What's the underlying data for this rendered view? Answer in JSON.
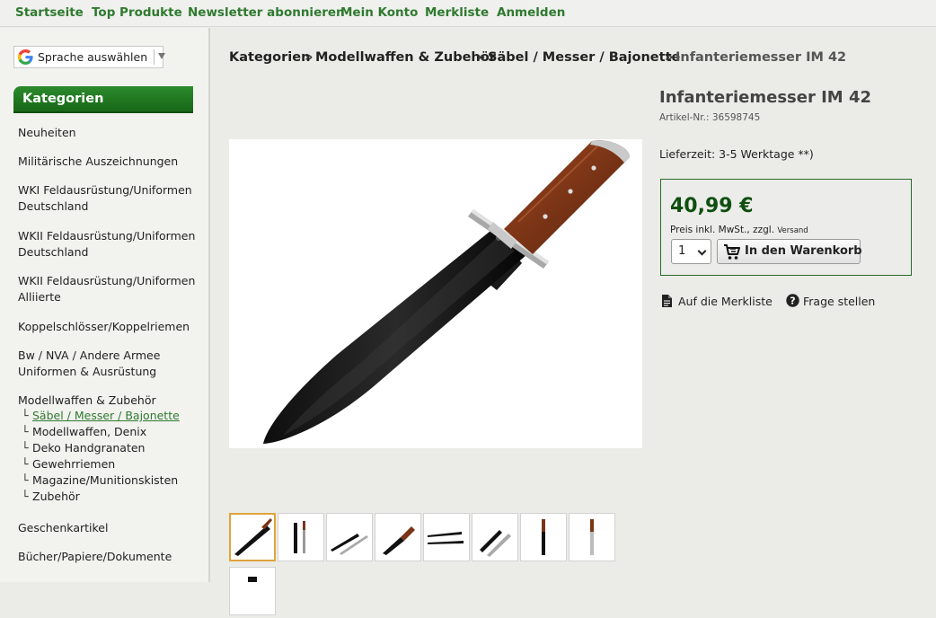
{
  "topnav": {
    "items": [
      "Startseite",
      "Top Produkte",
      "Newsletter abonnieren",
      "Mein Konto",
      "Merkliste",
      "Anmelden"
    ]
  },
  "language": {
    "label": "Sprache auswählen"
  },
  "sidebar": {
    "heading": "Kategorien",
    "items": [
      "Neuheiten",
      "Militärische Auszeichnungen",
      "WKI Feldausrüstung/Uniformen Deutschland",
      "WKII Feldausrüstung/Uniformen Deutschland",
      "WKII Feldausrüstung/Uniformen Alliierte",
      "Koppelschlösser/Koppelriemen",
      "Bw / NVA / Andere Armee Uniformen & Ausrüstung",
      "Modellwaffen & Zubehör",
      "Geschenkartikel",
      "Bücher/Papiere/Dokumente"
    ],
    "subitems": [
      "Säbel / Messer / Bajonette",
      "Modellwaffen, Denix",
      "Deko Handgranaten",
      "Gewehrriemen",
      "Magazine/Munitionskisten",
      "Zubehör"
    ]
  },
  "breadcrumb": {
    "items": [
      "Kategorien",
      "Modellwaffen & Zubehör",
      "Säbel / Messer / Bajonette",
      "Infanteriemesser IM 42"
    ],
    "separator": "»"
  },
  "product": {
    "title": "Infanteriemesser IM 42",
    "article_no": "Artikel-Nr.: 36598745",
    "delivery": "Lieferzeit: 3-5 Werktage **)",
    "price": "40,99 €",
    "vat_note": "Preis inkl. MwSt., zzgl.",
    "shipping_link": "Versand",
    "quantity": "1",
    "cart_button": "In den Warenkorb",
    "wishlist_link": "Auf die Merkliste",
    "question_link": "Frage stellen"
  },
  "colors": {
    "nav_green": "#2f7a2f",
    "category_header": "#1e7a1e",
    "price_green": "#0f4f0f",
    "thumb_selected": "#e0a43a"
  }
}
